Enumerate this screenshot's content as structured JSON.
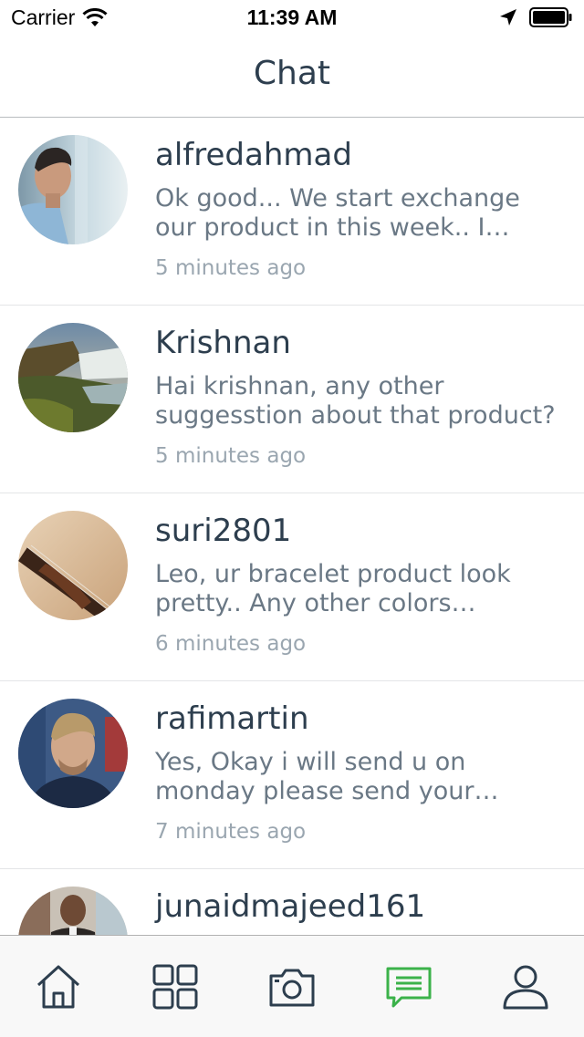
{
  "status_bar": {
    "carrier": "Carrier",
    "time": "11:39 AM",
    "icons": [
      "wifi-icon",
      "location-arrow-icon",
      "battery-icon"
    ]
  },
  "nav": {
    "title": "Chat"
  },
  "chats": [
    {
      "name": "alfredahmad",
      "preview": "Ok good... We start exchange our product in this week.. I accept your request",
      "time": "5 minutes ago",
      "avatar": "man-in-blue-shirt-photo"
    },
    {
      "name": "Krishnan",
      "preview": "Hai krishnan, any other suggesstion about that product?",
      "time": "5 minutes ago",
      "avatar": "waterfall-landscape-photo"
    },
    {
      "name": "suri2801",
      "preview": "Leo, ur bracelet product look pretty.. Any other colors available",
      "time": "6 minutes ago",
      "avatar": "violin-photo"
    },
    {
      "name": "rafimartin",
      "preview": "Yes, Okay i will send u on monday please send your address",
      "time": "7 minutes ago",
      "avatar": "man-portrait-photo"
    },
    {
      "name": "junaidmajeed161",
      "preview": "",
      "time": "",
      "avatar": "man-in-suit-photo"
    }
  ],
  "tab_bar": {
    "tabs": [
      {
        "icon": "home-icon",
        "active": false
      },
      {
        "icon": "grid-icon",
        "active": false
      },
      {
        "icon": "camera-icon",
        "active": false
      },
      {
        "icon": "chat-icon",
        "active": true
      },
      {
        "icon": "profile-icon",
        "active": false
      }
    ],
    "active_color": "#3bb24a",
    "inactive_color": "#2d3e4e"
  },
  "colors": {
    "title": "#2d3e4e",
    "preview": "#6a7885",
    "timestamp": "#9aa6b0",
    "divider": "#e3e5e7"
  }
}
